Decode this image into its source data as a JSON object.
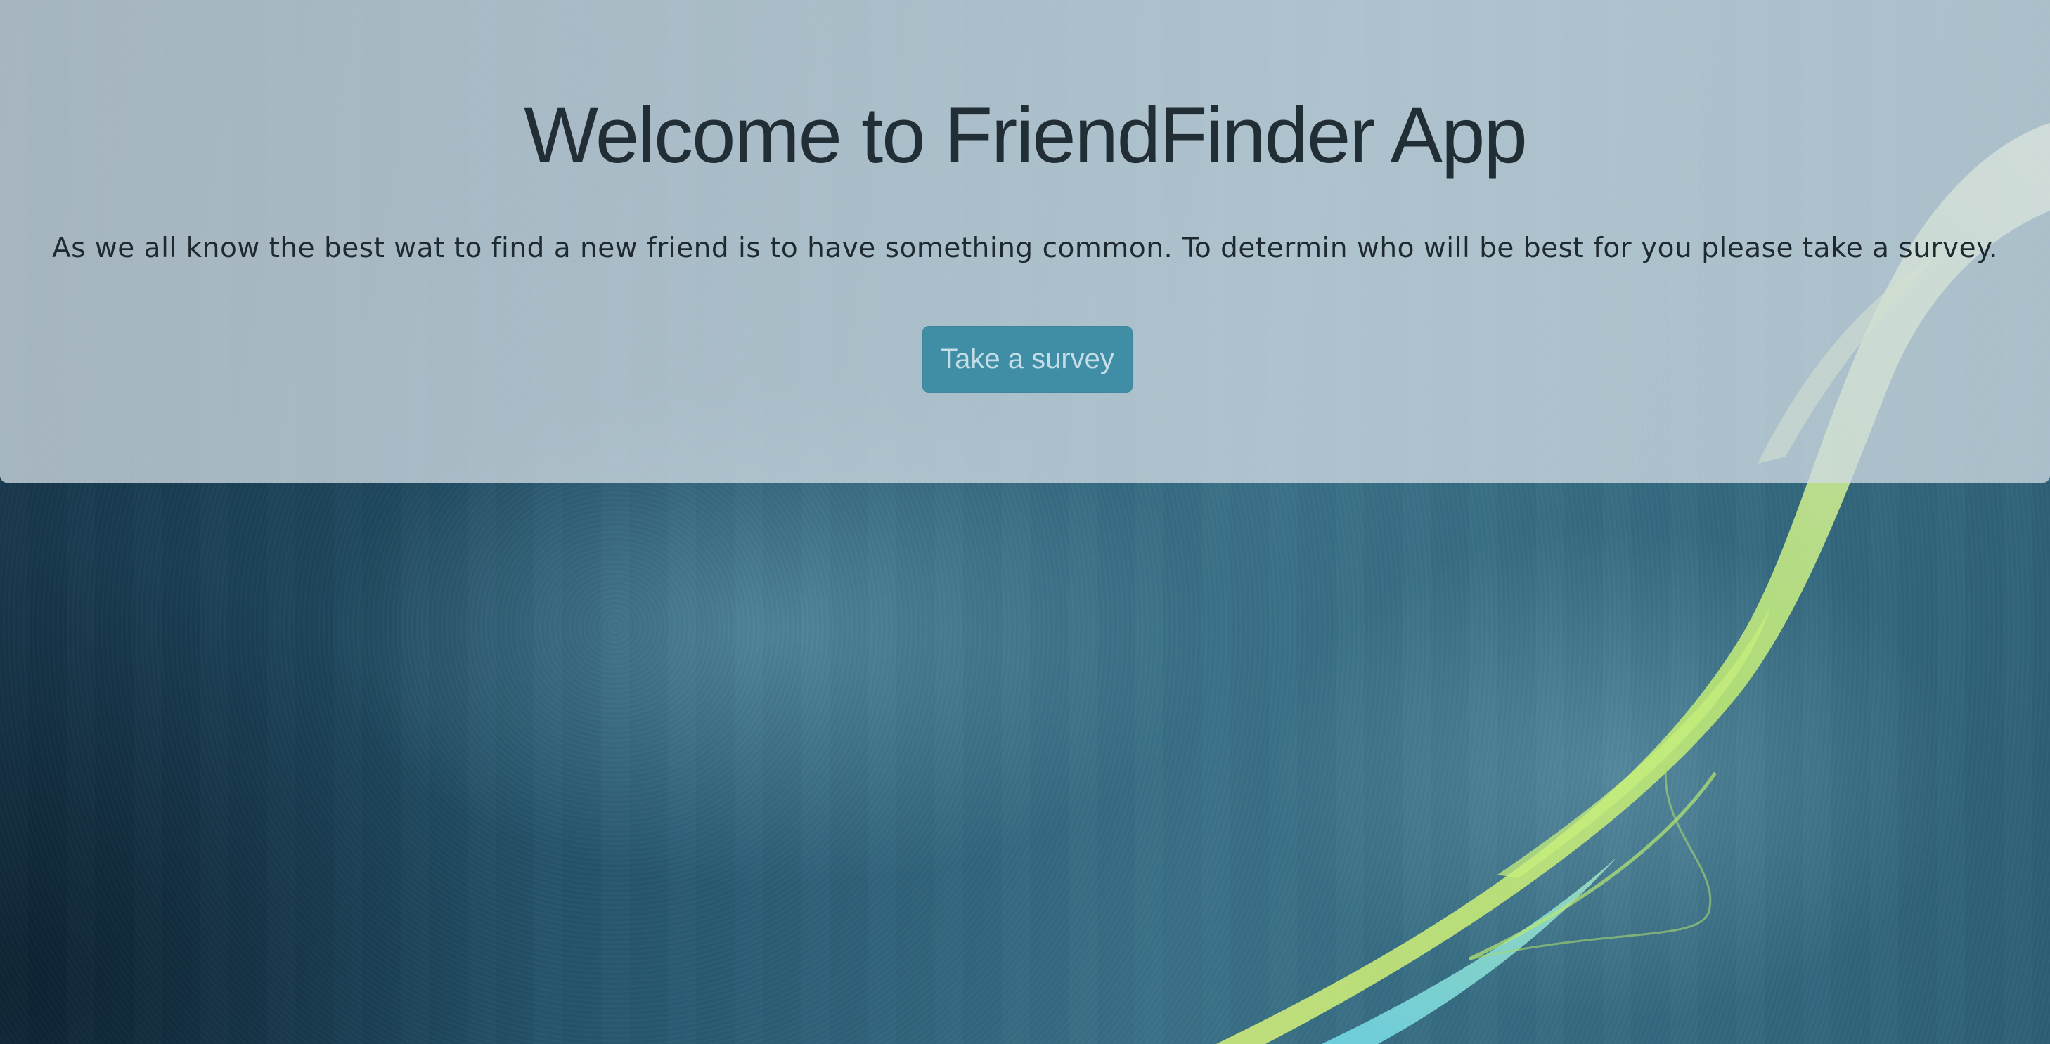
{
  "jumbotron": {
    "title": "Welcome to FriendFinder App",
    "description": "As we all know the best wat to find a new friend is to have something common. To determin who will be best for you please take a survey.",
    "survey_button_label": "Take a survey"
  },
  "colors": {
    "panel_overlay": "#ceddE2",
    "button_bg": "#3f8ea6",
    "button_text": "#c4dde6",
    "heading_text": "#212e36",
    "background_teal": "#26566e",
    "ribbon_green": "#c8f07a",
    "ribbon_blue": "#6fd0e0"
  }
}
